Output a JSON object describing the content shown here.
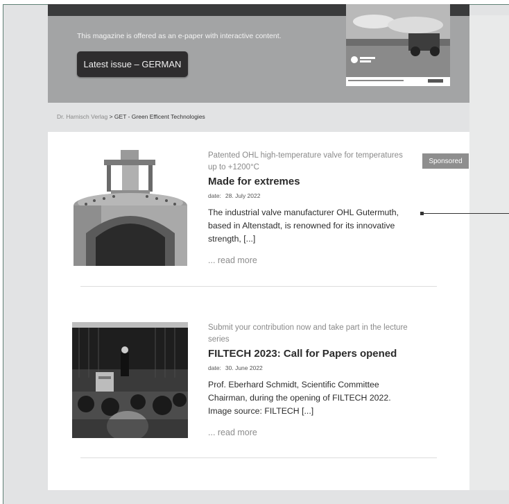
{
  "hero": {
    "text": "This magazine is offered as an e-paper with interactive content.",
    "button_label": "Latest issue – GERMAN"
  },
  "breadcrumb": {
    "publisher": "Dr. Harnisch Verlag",
    "separator": " > ",
    "current": "GET - Green Efficent Technologies"
  },
  "sponsored_label": "Sponsored",
  "articles": [
    {
      "subtitle": "Patented OHL high-temperature valve for temperatures up to +1200°C",
      "title": "Made for extremes",
      "date_label": "date:",
      "date": "28. July 2022",
      "excerpt": "The industrial valve manufacturer OHL Gutermuth, based in Altenstadt, is renowned for its innovative strength, [...]",
      "read_more": "... read more"
    },
    {
      "subtitle": "Submit your contribution now and take part in the lecture series",
      "title": "FILTECH 2023: Call for Papers opened",
      "date_label": "date:",
      "date": "30. June 2022",
      "excerpt": "Prof. Eberhard Schmidt, Scientific Committee Chairman, during the opening of FILTECH 2022. Image source: FILTECH [...]",
      "read_more": "... read more"
    }
  ],
  "colors": {
    "hero_bg": "#a3a4a5",
    "button_bg": "#2e2d2e",
    "sponsored_bg": "#8e8e8e",
    "page_bg": "#e2e3e4"
  }
}
